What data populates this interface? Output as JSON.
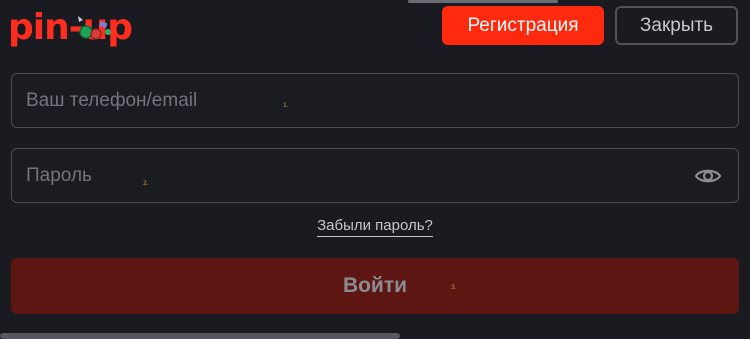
{
  "header": {
    "logo_text": "pin-up",
    "register_label": "Регистрация",
    "close_label": "Закрыть"
  },
  "form": {
    "login_placeholder": "Ваш телефон/email",
    "password_placeholder": "Пароль",
    "forgot_label": "Забыли пароль?",
    "submit_label": "Войти",
    "markers": [
      "1.",
      "2.",
      "3."
    ]
  },
  "icons": {
    "password_toggle": "eye-icon",
    "logo_decoration": "chips-icon"
  },
  "colors": {
    "background": "#191b21",
    "accent": "#ff2a0d",
    "logo": "#ff2d20",
    "submit_disabled": "#5e1613"
  }
}
